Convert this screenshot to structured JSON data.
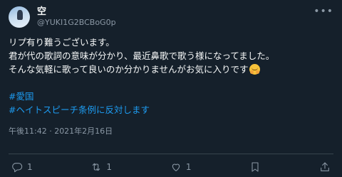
{
  "user": {
    "display_name": "空",
    "handle": "@YUKI1G2BCBoG0p"
  },
  "more_icon": "more-horizontal-icon",
  "tweet": {
    "lines": [
      "リプ有り難うございます。",
      "君が代の歌詞の意味が分かり、最近鼻歌で歌う様になってました。",
      "そんな気軽に歌って良いのか分かりませんがお気に入りです"
    ],
    "emoji": "hugging-face-emoji",
    "hashtags": [
      "#愛国",
      "#ヘイトスピーチ条例に反対します"
    ],
    "timestamp": "午後11:42 · 2021年2月16日"
  },
  "actions": {
    "reply_count": "1",
    "retweet_count": "1",
    "like_count": "1",
    "icons": [
      "reply-icon",
      "retweet-icon",
      "like-icon",
      "bookmark-icon",
      "share-icon"
    ]
  },
  "colors": {
    "background": "#15202b",
    "text": "#f7f9f9",
    "muted": "#8b98a5",
    "link": "#1d9bf0",
    "divider": "#38444d"
  }
}
